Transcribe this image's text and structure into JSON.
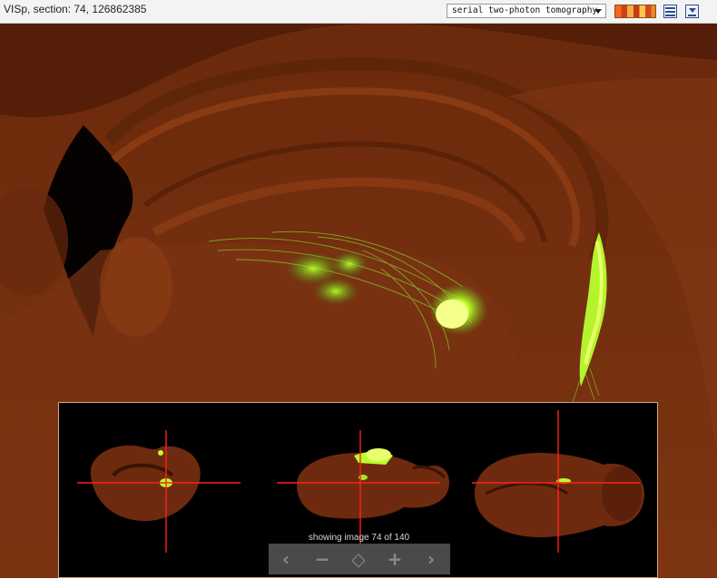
{
  "header": {
    "title": "VISp, section: 74, 126862385",
    "modality_select": {
      "selected": "serial two-photon tomography",
      "icon": "dropdown-arrow-icon"
    },
    "tools": [
      {
        "name": "colormap-icon"
      },
      {
        "name": "table-icon"
      },
      {
        "name": "download-icon"
      }
    ]
  },
  "viewer": {
    "background_color": "#4a1e08",
    "tissue_color": "#7a3410",
    "signal_color": "#b7ff2e"
  },
  "navigator": {
    "caption": "showing image 74 of 140",
    "crosshair_color": "#ff1e1e",
    "controls": {
      "previous": "‹",
      "zoom_out": "−",
      "pan": "◇",
      "zoom_in": "+",
      "next": "›"
    }
  }
}
